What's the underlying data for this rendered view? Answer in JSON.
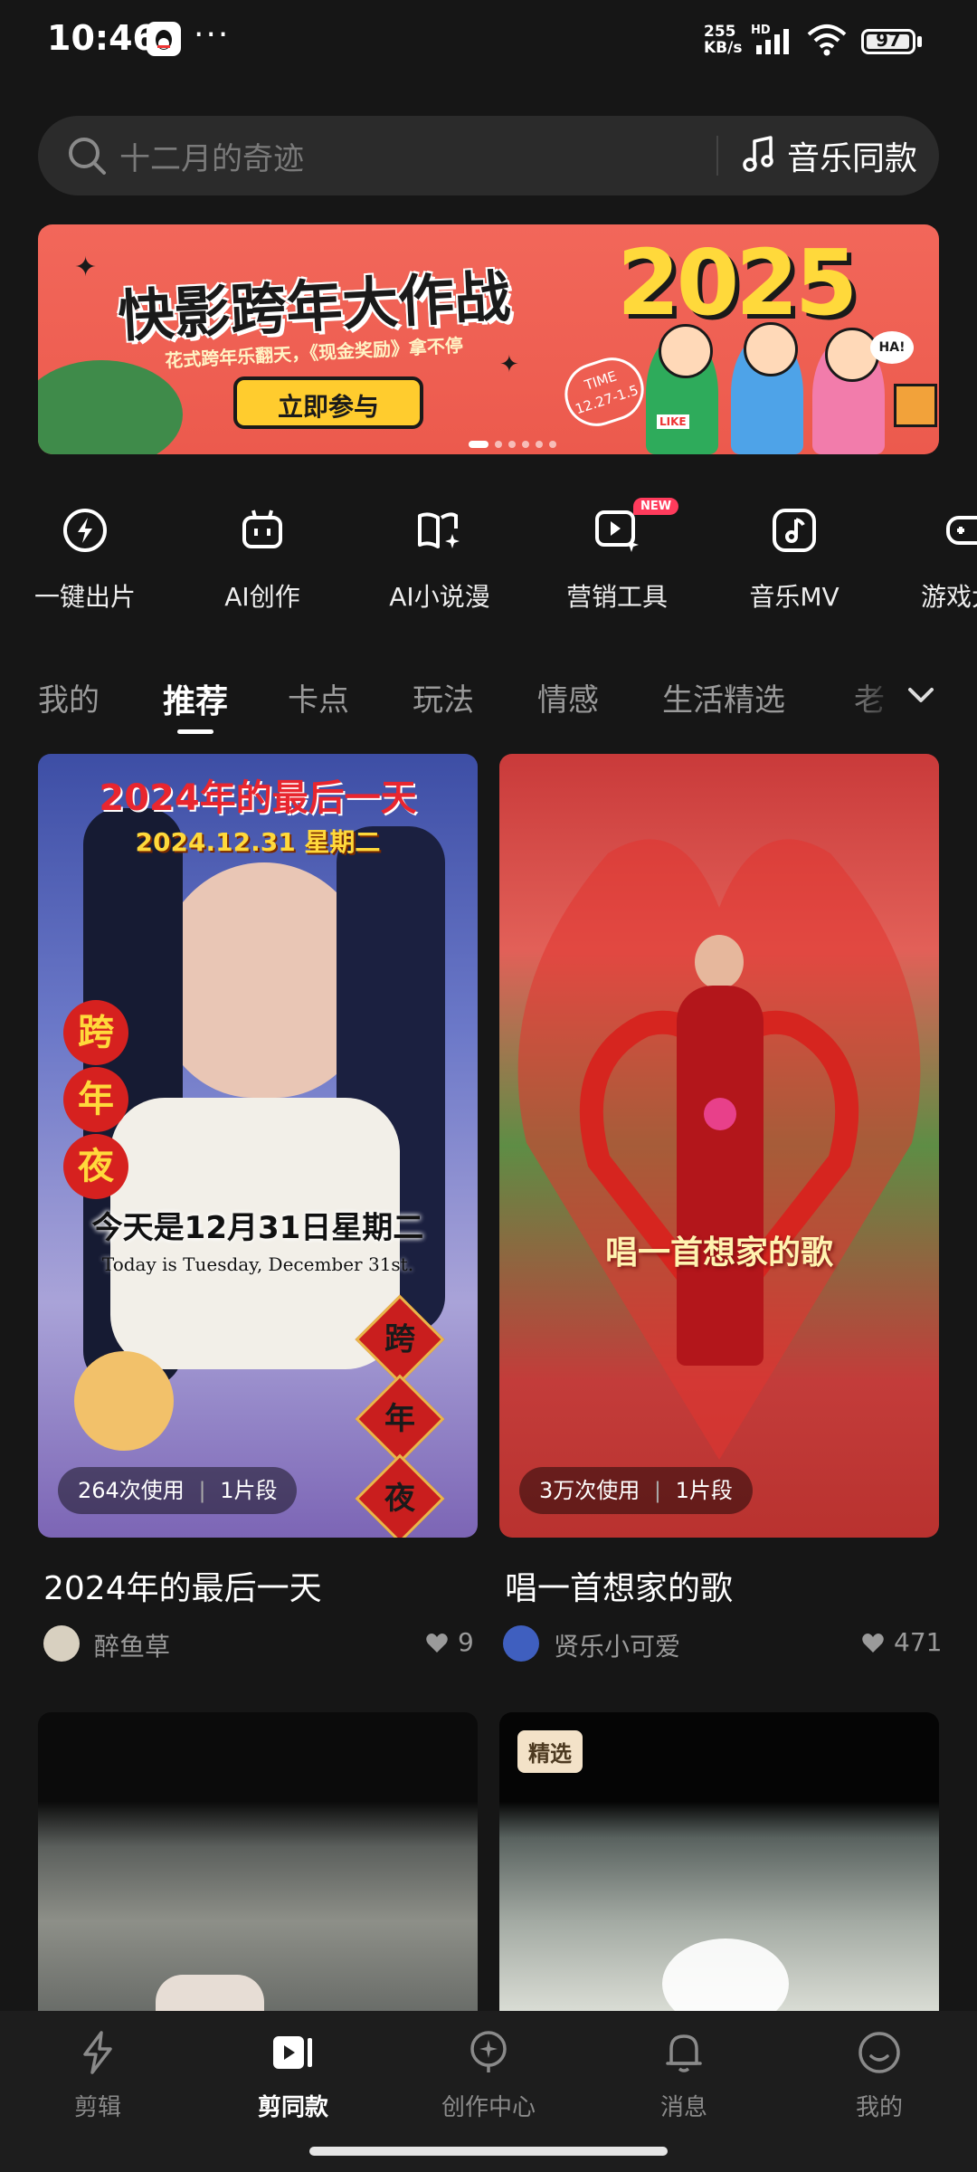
{
  "status": {
    "time": "10:46",
    "net_speed_value": "255",
    "net_speed_unit": "KB/s",
    "hd": "HD",
    "battery": "97",
    "battery_level": 0.97
  },
  "search": {
    "placeholder": "十二月的奇迹",
    "music_same_label": "音乐同款"
  },
  "banner": {
    "title": "快影跨年大作战",
    "year": "2025",
    "subtitle": "花式跨年乐翻天，《现金奖励》拿不停",
    "button_label": "立即参与",
    "time_label": "TIME",
    "time_range": "12.27-1.5",
    "badge_ha": "HA!",
    "badge_like": "LIKE",
    "page_count": 6,
    "active_page": 1
  },
  "tools": [
    {
      "label": "一键出片",
      "icon": "lightning-icon"
    },
    {
      "label": "AI创作",
      "icon": "ai-robot-icon"
    },
    {
      "label": "AI小说漫",
      "icon": "book-sparkle-icon"
    },
    {
      "label": "营销工具",
      "icon": "video-sparkle-icon",
      "badge": "NEW"
    },
    {
      "label": "音乐MV",
      "icon": "music-note-icon"
    },
    {
      "label": "游戏大",
      "icon": "gamepad-icon"
    }
  ],
  "categories": [
    {
      "label": "我的"
    },
    {
      "label": "推荐",
      "active": true
    },
    {
      "label": "卡点"
    },
    {
      "label": "玩法"
    },
    {
      "label": "情感"
    },
    {
      "label": "生活精选"
    },
    {
      "label": "老"
    }
  ],
  "cards": [
    {
      "title": "2024年的最后一天",
      "overlay_title": "2024年的最后一天",
      "overlay_date": "2024.12.31 星期二",
      "overlay_side": [
        "跨",
        "年",
        "夜"
      ],
      "overlay_line1": "今天是12月31日星期二",
      "overlay_line2": "Today is Tuesday, December 31st.",
      "overlay_diamonds": [
        "跨",
        "年",
        "夜"
      ],
      "usage": "264次使用",
      "segments": "1片段",
      "author": "醉鱼草",
      "likes": "9"
    },
    {
      "title": "唱一首想家的歌",
      "overlay_text": "唱一首想家的歌",
      "usage": "3万次使用",
      "segments": "1片段",
      "author": "贤乐小可爱",
      "likes": "471"
    }
  ],
  "featured_badge": "精选",
  "nav": [
    {
      "label": "剪辑",
      "icon": "edit-lightning-icon"
    },
    {
      "label": "剪同款",
      "icon": "template-play-icon",
      "active": true
    },
    {
      "label": "创作中心",
      "icon": "creator-center-icon"
    },
    {
      "label": "消息",
      "icon": "bell-icon"
    },
    {
      "label": "我的",
      "icon": "profile-smile-icon"
    }
  ],
  "colors": {
    "background": "#161616",
    "accent_new": "#ff3b5c",
    "banner_bg": "#ec5a4d",
    "banner_year": "#ffd93b",
    "banner_button": "#ffcc2e"
  }
}
